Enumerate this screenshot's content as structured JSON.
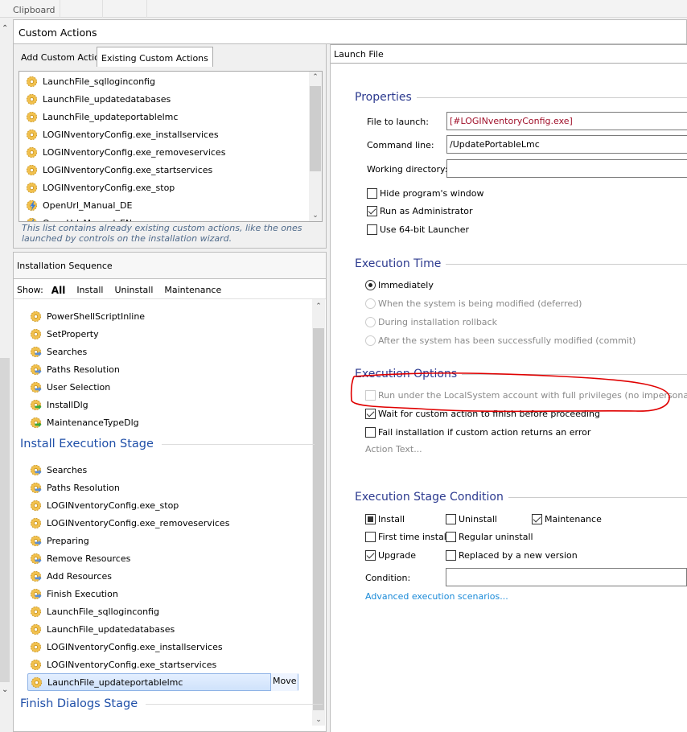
{
  "ribbon": {
    "group_label": "Clipboard"
  },
  "custom_actions": {
    "title": "Custom Actions",
    "tabs": [
      {
        "label": "Add Custom Action",
        "active": false
      },
      {
        "label": "Existing Custom Actions",
        "active": true
      }
    ],
    "existing": [
      {
        "label": "LaunchFile_sqlloginconfig",
        "icon": "gear-icon"
      },
      {
        "label": "LaunchFile_updatedatabases",
        "icon": "gear-icon"
      },
      {
        "label": "LaunchFile_updateportablelmc",
        "icon": "gear-icon"
      },
      {
        "label": "LOGINventoryConfig.exe_installservices",
        "icon": "gear-icon"
      },
      {
        "label": "LOGINventoryConfig.exe_removeservices",
        "icon": "gear-icon"
      },
      {
        "label": "LOGINventoryConfig.exe_startservices",
        "icon": "gear-icon"
      },
      {
        "label": "LOGINventoryConfig.exe_stop",
        "icon": "gear-icon"
      },
      {
        "label": "OpenUrl_Manual_DE",
        "icon": "lightning-gear-icon"
      },
      {
        "label": "OpenUrl_Manual_EN",
        "icon": "lightning-gear-icon"
      }
    ],
    "caption": "This list contains already existing custom actions, like the ones launched by controls on the installation wizard."
  },
  "sequence": {
    "title": "Installation Sequence",
    "show_label": "Show:",
    "filters": [
      {
        "label": "All",
        "active": true
      },
      {
        "label": "Install"
      },
      {
        "label": "Uninstall"
      },
      {
        "label": "Maintenance"
      }
    ],
    "pre_items": [
      {
        "label": "PowerShellScriptInline",
        "icon": "gear"
      },
      {
        "label": "SetProperty",
        "icon": "gear"
      },
      {
        "label": "Searches",
        "icon": "std"
      },
      {
        "label": "Paths Resolution",
        "icon": "std"
      },
      {
        "label": "User Selection",
        "icon": "std"
      },
      {
        "label": "InstallDlg",
        "icon": "dlg"
      },
      {
        "label": "MaintenanceTypeDlg",
        "icon": "dlg"
      }
    ],
    "install_stage": "Install Execution Stage",
    "install_items": [
      {
        "label": "Searches",
        "icon": "std"
      },
      {
        "label": "Paths Resolution",
        "icon": "std"
      },
      {
        "label": "LOGINventoryConfig.exe_stop",
        "icon": "gear"
      },
      {
        "label": "LOGINventoryConfig.exe_removeservices",
        "icon": "gear"
      },
      {
        "label": "Preparing",
        "icon": "std"
      },
      {
        "label": "Remove Resources",
        "icon": "std"
      },
      {
        "label": "Add Resources",
        "icon": "std"
      },
      {
        "label": "Finish Execution",
        "icon": "std"
      },
      {
        "label": "LaunchFile_sqlloginconfig",
        "icon": "gear"
      },
      {
        "label": "LaunchFile_updatedatabases",
        "icon": "gear"
      },
      {
        "label": "LOGINventoryConfig.exe_installservices",
        "icon": "gear"
      },
      {
        "label": "LOGINventoryConfig.exe_startservices",
        "icon": "gear"
      },
      {
        "label": "LaunchFile_updateportablelmc",
        "icon": "gear",
        "selected": true
      }
    ],
    "move_label": "Move",
    "finish_stage": "Finish Dialogs Stage"
  },
  "launch_file": {
    "title": "Launch File",
    "properties": {
      "heading": "Properties",
      "file_label": "File to launch:",
      "file_value": "[#LOGINventoryConfig.exe]",
      "cmd_label": "Command line:",
      "cmd_value": "/UpdatePortableLmc",
      "wd_label": "Working directory:",
      "wd_value": "",
      "hide": {
        "label": "Hide program's window",
        "checked": false
      },
      "admin": {
        "label": "Run as Administrator",
        "checked": true
      },
      "x64": {
        "label": "Use 64-bit Launcher",
        "checked": false
      }
    },
    "exec_time": {
      "heading": "Execution Time",
      "options": [
        {
          "label": "Immediately",
          "selected": true,
          "enabled": true
        },
        {
          "label": "When the system is being modified (deferred)",
          "enabled": false
        },
        {
          "label": "During installation rollback",
          "enabled": false
        },
        {
          "label": "After the system has been successfully modified (commit)",
          "enabled": false
        }
      ]
    },
    "exec_options": {
      "heading": "Execution Options",
      "localsystem": {
        "label": "Run under the LocalSystem account with full privileges (no impersonation)",
        "checked": false,
        "enabled": false
      },
      "wait": {
        "label": "Wait for custom action to finish before proceeding",
        "checked": true
      },
      "fail": {
        "label": "Fail installation if custom action returns an error",
        "checked": false
      },
      "action_text": "Action Text..."
    },
    "stage_condition": {
      "heading": "Execution Stage Condition",
      "install": {
        "label": "Install",
        "state": "indeterminate"
      },
      "uninstall": {
        "label": "Uninstall",
        "checked": false
      },
      "maintenance": {
        "label": "Maintenance",
        "checked": true
      },
      "first_time": {
        "label": "First time install",
        "checked": false
      },
      "regular_uninstall": {
        "label": "Regular uninstall",
        "checked": false
      },
      "upgrade": {
        "label": "Upgrade",
        "checked": true
      },
      "replaced": {
        "label": "Replaced by a new version",
        "checked": false
      },
      "condition_label": "Condition:",
      "condition_value": "",
      "advanced_link": "Advanced execution scenarios..."
    }
  },
  "colors": {
    "annotation": "#e00000",
    "accent": "#1f4fa8",
    "link": "#1a8ad8",
    "file_value": "#a0102a"
  }
}
